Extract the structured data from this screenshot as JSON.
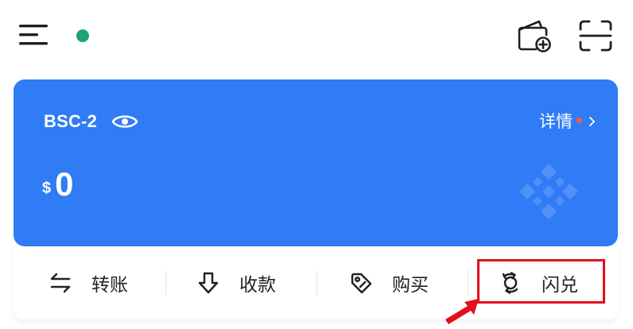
{
  "header": {
    "menu_icon": "hamburger-menu-icon",
    "status_color": "#1aa37a",
    "add_wallet_icon": "wallet-add-icon",
    "scan_icon": "scan-icon"
  },
  "wallet": {
    "name": "BSC-2",
    "details_label": "详情",
    "currency_symbol": "$",
    "balance": "0",
    "card_color": "#2f7cf6",
    "notice_color": "#ff5a3c",
    "chain_icon": "bnb-chain-icon"
  },
  "actions": [
    {
      "label": "转账",
      "icon": "transfer-arrows-icon"
    },
    {
      "label": "收款",
      "icon": "receive-download-icon"
    },
    {
      "label": "购买",
      "icon": "price-tag-icon"
    },
    {
      "label": "闪兑",
      "icon": "swap-refresh-icon"
    }
  ],
  "annotation": {
    "highlight_color": "#e0101c",
    "target": "闪兑"
  }
}
